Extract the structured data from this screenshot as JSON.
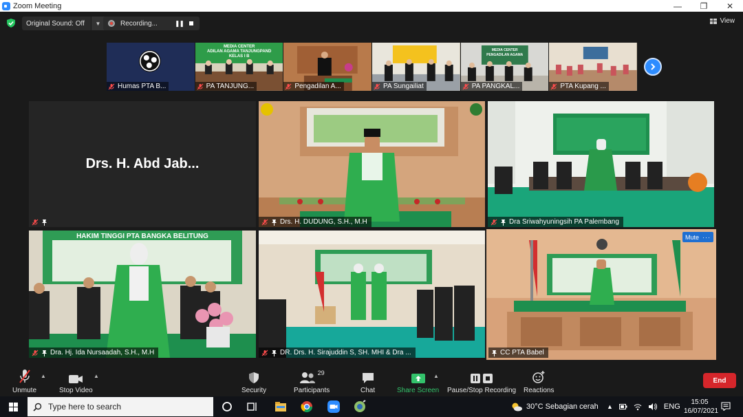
{
  "window": {
    "title": "Zoom Meeting"
  },
  "topbar": {
    "original_sound": "Original Sound: Off",
    "recording": "Recording...",
    "view": "View"
  },
  "thumbnails": [
    {
      "name": "Humas PTA B..."
    },
    {
      "name": "PA TANJUNG..."
    },
    {
      "name": "Pengadilan A..."
    },
    {
      "name": "PA Sungailiat"
    },
    {
      "name": "PA PANGKAL..."
    },
    {
      "name": "PTA Kupang ..."
    }
  ],
  "thumbnail_text": {
    "banner_tanjung": "MEDIA CENTER\nADILAN AGAMA TANJUNGPAND\nKELAS I B",
    "banner_pangkal": "MEDIA CENTER\nPENGADILAN AGAMA"
  },
  "gallery": {
    "tile1": {
      "big_name": "Drs. H. Abd Jab..."
    },
    "tile2": {
      "name": "Drs. H. DUDUNG, S.H., M.H"
    },
    "tile3": {
      "name": "Dra Sriwahyuningsih PA Palembang"
    },
    "tile4": {
      "name": "Dra. Hj. Ida Nursaadah, S.H., M.H",
      "banner": "HAKIM TINGGI PTA BANGKA BELITUNG"
    },
    "tile5": {
      "name": "DR. Drs. H. Sirajuddin S, SH. MHI & Dra ..."
    },
    "tile6": {
      "name": "CC PTA Babel",
      "mute_label": "Mute",
      "more_label": "···"
    }
  },
  "controls": {
    "unmute": "Unmute",
    "stop_video": "Stop Video",
    "security": "Security",
    "participants": "Participants",
    "participants_count": "29",
    "chat": "Chat",
    "share_screen": "Share Screen",
    "pause_stop_recording": "Pause/Stop Recording",
    "reactions": "Reactions",
    "end": "End"
  },
  "taskbar": {
    "search_placeholder": "Type here to search",
    "weather": "30°C  Sebagian cerah",
    "language": "ENG",
    "time": "15:05",
    "date": "16/07/2021"
  },
  "colors": {
    "zoom_blue": "#2d8cff",
    "share_green": "#33c36b",
    "end_red": "#d6262b",
    "active_speaker": "#d4e157",
    "court_green": "#1e8f4e"
  }
}
